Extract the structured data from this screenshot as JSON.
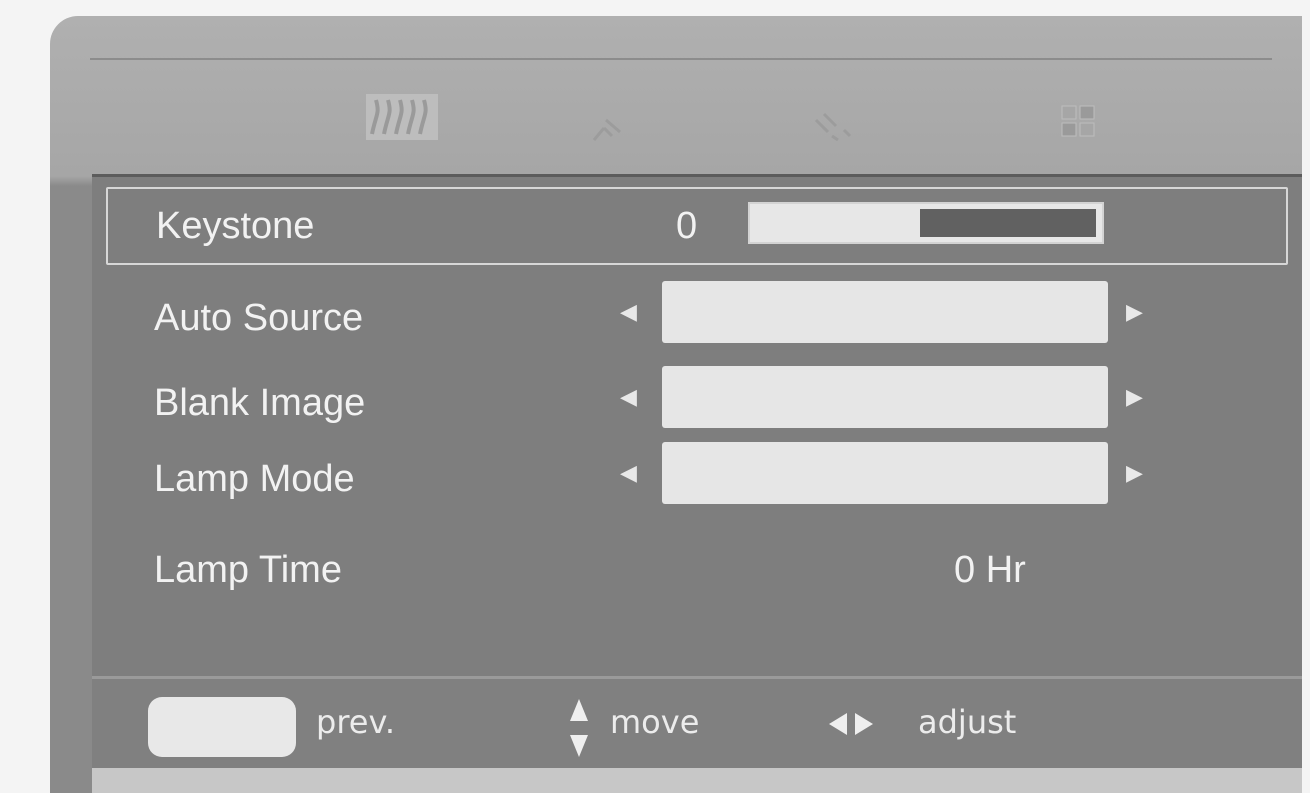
{
  "menu": {
    "tabs": [
      {
        "icon": "picture-tab-icon"
      },
      {
        "icon": "audio-tab-icon"
      },
      {
        "icon": "setup-tab-icon"
      },
      {
        "icon": "option-tab-icon"
      }
    ],
    "items": [
      {
        "label": "Keystone",
        "value": "0",
        "level": 0.5,
        "selected": true
      },
      {
        "label": "Auto Source",
        "value": ""
      },
      {
        "label": "Blank Image",
        "value": ""
      },
      {
        "label": "Lamp Mode",
        "value": ""
      },
      {
        "label": "Lamp Time",
        "value": "0 Hr"
      }
    ]
  },
  "footer": {
    "prev_label": "prev.",
    "move_label": "move",
    "adjust_label": "adjust"
  }
}
